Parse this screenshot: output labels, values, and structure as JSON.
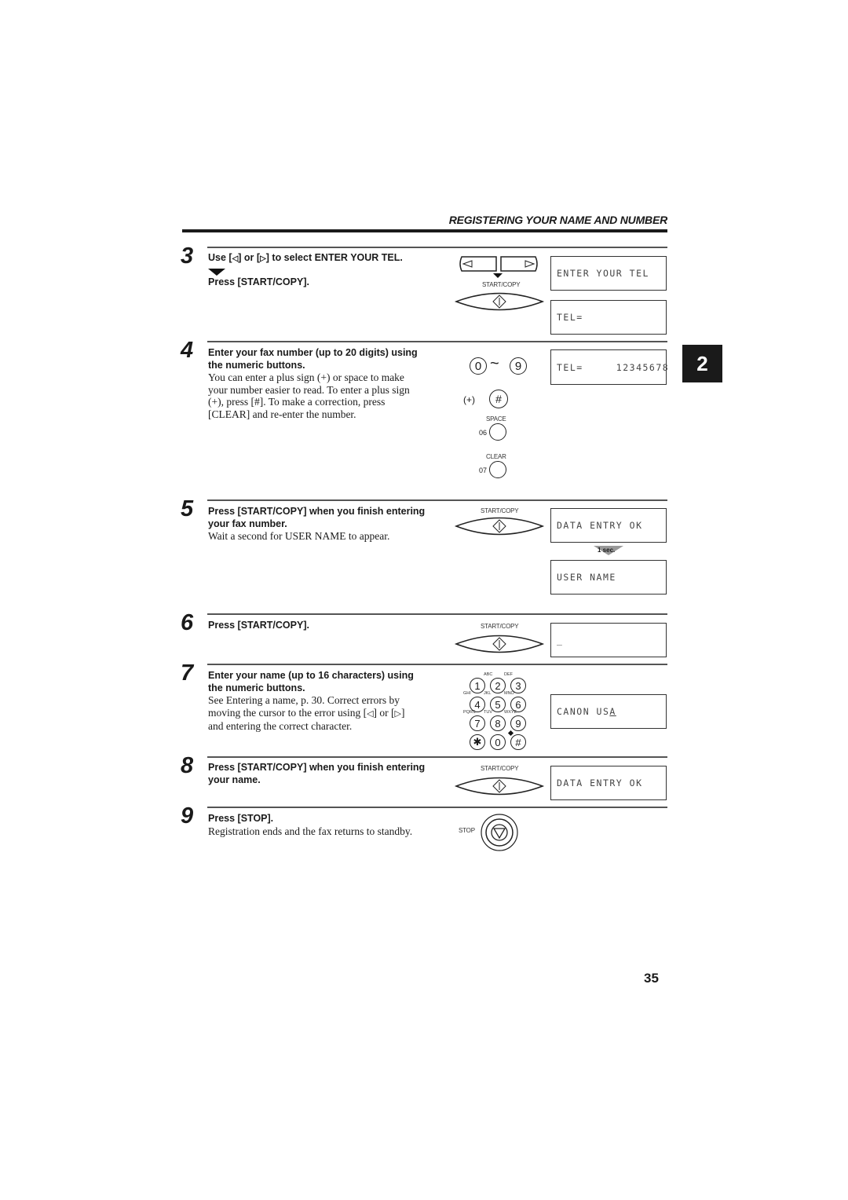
{
  "header": {
    "title": "REGISTERING YOUR NAME AND NUMBER"
  },
  "chapter_tab": "2",
  "page_number": "35",
  "steps": [
    {
      "number": "3",
      "instruction_a_pre": "Use [",
      "instruction_a_mid": "] or [",
      "instruction_a_post": "] to select ENTER YOUR TEL.",
      "instruction_b": "Press [START/COPY].",
      "button_label": "START/COPY",
      "lcd": [
        "ENTER YOUR TEL",
        "TEL="
      ]
    },
    {
      "number": "4",
      "instruction_line1": "Enter your fax number (up to 20 digits) using",
      "instruction_line2": "the numeric buttons.",
      "body": [
        "You can enter a plus sign (+) or space to make",
        "your number easier to read. To enter a plus sign",
        "(+), press [#]. To make a correction, press",
        "[CLEAR] and re-enter the number."
      ],
      "keys": {
        "range_start": "0",
        "range_sep": "~",
        "range_end": "9",
        "plus_label": "(+)",
        "hash": "#",
        "space_label": "SPACE",
        "space_code": "06",
        "clear_label": "CLEAR",
        "clear_code": "07"
      },
      "lcd": [
        "TEL=     12345678"
      ]
    },
    {
      "number": "5",
      "instruction_line1": "Press [START/COPY] when you finish entering",
      "instruction_line2": "your fax number.",
      "body": "Wait a second for USER NAME to appear.",
      "button_label": "START/COPY",
      "lcd": [
        "DATA ENTRY OK",
        "USER NAME"
      ],
      "delay_label": "1 sec."
    },
    {
      "number": "6",
      "instruction": "Press [START/COPY].",
      "button_label": "START/COPY",
      "lcd": [
        "_"
      ]
    },
    {
      "number": "7",
      "instruction_line1": "Enter your name (up to 16 characters) using",
      "instruction_line2": "the numeric buttons.",
      "body_line1": "See Entering a name, p. 30. Correct errors by",
      "body_line2_pre": "moving the cursor to the error using [",
      "body_line2_mid": "] or [",
      "body_line2_post": "]",
      "body_line3": "and entering the correct character.",
      "keypad": [
        {
          "key": "1",
          "sub": ""
        },
        {
          "key": "2",
          "sub": "ABC"
        },
        {
          "key": "3",
          "sub": "DEF"
        },
        {
          "key": "4",
          "sub": "GHI"
        },
        {
          "key": "5",
          "sub": "JKL"
        },
        {
          "key": "6",
          "sub": "MNO"
        },
        {
          "key": "7",
          "sub": "PQRS"
        },
        {
          "key": "8",
          "sub": "TUV"
        },
        {
          "key": "9",
          "sub": "WXYZ"
        },
        {
          "key": "✱",
          "sub": ""
        },
        {
          "key": "0",
          "sub": ""
        },
        {
          "key": "#",
          "sub": ""
        }
      ],
      "lcd_text": "CANON US",
      "lcd_cursor": "A"
    },
    {
      "number": "8",
      "instruction_line1": "Press [START/COPY] when you finish entering",
      "instruction_line2": "your name.",
      "button_label": "START/COPY",
      "lcd": [
        "DATA ENTRY OK"
      ]
    },
    {
      "number": "9",
      "instruction": "Press [STOP].",
      "body": "Registration ends and the fax returns to standby.",
      "button_label": "STOP"
    }
  ]
}
